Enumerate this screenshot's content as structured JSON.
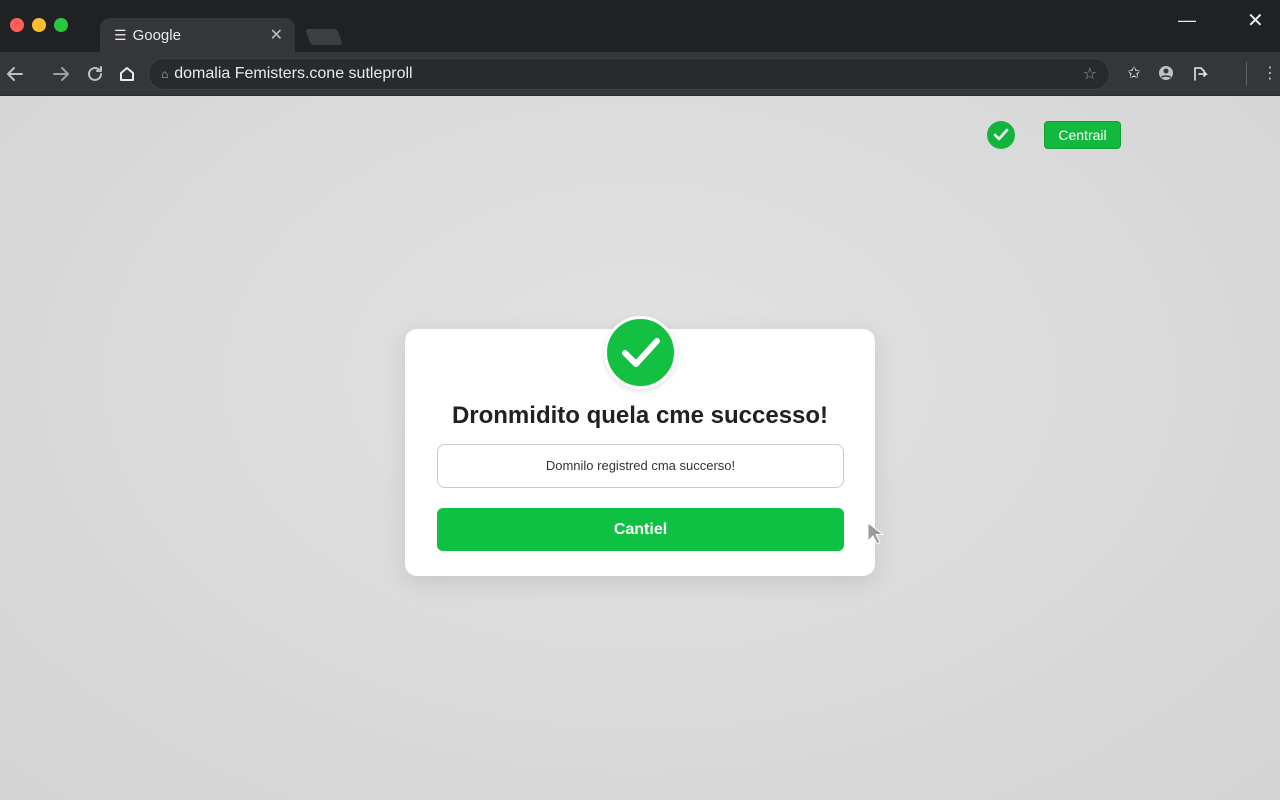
{
  "browser": {
    "tab_title": "Google",
    "url": "domalia Femisters.cone sutleproll"
  },
  "page": {
    "top_button_label": "Centrail"
  },
  "dialog": {
    "title": "Dronmidito quela cme successo!",
    "field_value": "Domnilo registred cma succerso!",
    "button_label": "Cantiel"
  },
  "colors": {
    "accent_green": "#13c042",
    "browser_chrome": "#202124",
    "page_background": "#dcdcdc"
  },
  "icons": {
    "window_controls": [
      "close-dot",
      "minimize-dot",
      "maximize-dot"
    ],
    "toolbar": [
      "back-arrow-icon",
      "forward-arrow-icon",
      "reload-icon",
      "home-icon",
      "bookmark-star-icon",
      "extensions-icon",
      "account-icon",
      "profile-icon",
      "more-icon"
    ]
  }
}
